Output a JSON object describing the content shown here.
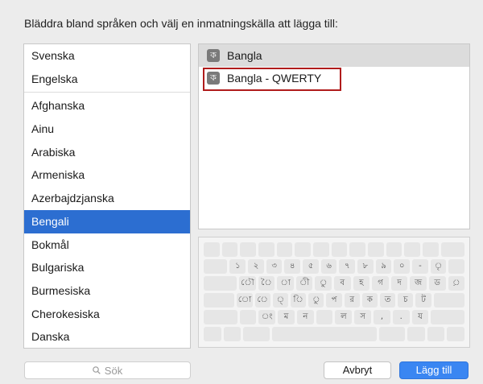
{
  "instruction": "Bläddra bland språken och välj en inmatningskälla att lägga till:",
  "languages": {
    "top": [
      "Svenska",
      "Engelska"
    ],
    "rest": [
      "Afghanska",
      "Ainu",
      "Arabiska",
      "Armeniska",
      "Azerbajdzjanska",
      "Bengali",
      "Bokmål",
      "Bulgariska",
      "Burmesiska",
      "Cherokesiska",
      "Danska"
    ],
    "selected": "Bengali"
  },
  "sources": {
    "items": [
      "Bangla",
      "Bangla - QWERTY"
    ],
    "glyph": "ক",
    "selected": "Bangla",
    "highlighted": "Bangla - QWERTY"
  },
  "keyboard": {
    "row1": [
      "১",
      "২",
      "৩",
      "৪",
      "৫",
      "৬",
      "৭",
      "৮",
      "৯",
      "০",
      "-",
      "ৃ"
    ],
    "row2": [
      "ৌ",
      "ৈ",
      "া",
      "ী",
      "ু",
      "ব",
      "হ",
      "গ",
      "দ",
      "জ",
      "ড",
      "়"
    ],
    "row3": [
      "ো",
      "ে",
      "্",
      "ি",
      "ু",
      "প",
      "র",
      "ক",
      "ত",
      "চ",
      "ট"
    ],
    "row4": [
      "ং",
      "ম",
      "ন",
      "ল",
      "স",
      ",",
      ".",
      "য"
    ]
  },
  "search": {
    "placeholder": "Sök",
    "icon": "magnifier-icon"
  },
  "buttons": {
    "cancel": "Avbryt",
    "add": "Lägg till"
  },
  "colors": {
    "selection": "#2c6ed1",
    "primary_button": "#3a86f2",
    "highlight_border": "#b01c1c"
  }
}
